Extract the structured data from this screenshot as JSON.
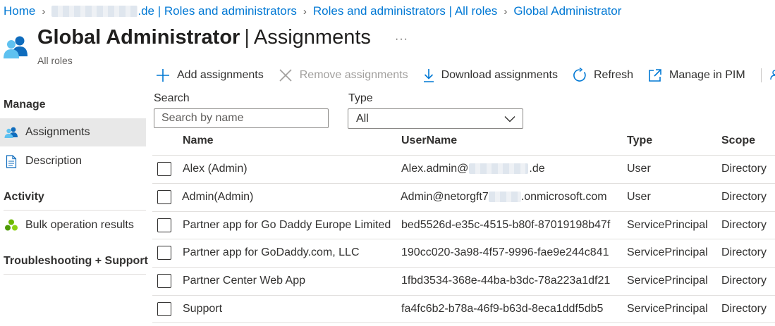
{
  "breadcrumb": {
    "home": "Home",
    "tenant_suffix": ".de | Roles and administrators",
    "roles_all": "Roles and administrators | All roles",
    "current": "Global Administrator"
  },
  "header": {
    "title_strong": "Global Administrator",
    "title_sep": "|",
    "title_sub": "Assignments",
    "more": "···",
    "subtitle": "All roles"
  },
  "toolbar": {
    "add": "Add assignments",
    "remove": "Remove assignments",
    "download": "Download assignments",
    "refresh": "Refresh",
    "manage_pim": "Manage in PIM"
  },
  "sidebar": {
    "manage_heading": "Manage",
    "assignments": "Assignments",
    "description": "Description",
    "activity_heading": "Activity",
    "bulk": "Bulk operation results",
    "troubleshooting_heading": "Troubleshooting + Support"
  },
  "filters": {
    "search_label": "Search",
    "search_placeholder": "Search by name",
    "type_label": "Type",
    "type_value": "All"
  },
  "table": {
    "headers": {
      "name": "Name",
      "username": "UserName",
      "type": "Type",
      "scope": "Scope"
    },
    "rows": [
      {
        "name": "Alex (Admin)",
        "user_prefix": "Alex.admin@",
        "user_suffix": ".de",
        "type": "User",
        "scope": "Directory"
      },
      {
        "name": "Admin(Admin)",
        "user_prefix": "Admin@netorgft7",
        "user_suffix": ".onmicrosoft.com",
        "type": "User",
        "scope": "Directory"
      },
      {
        "name": "Partner app for Go Daddy Europe Limited",
        "username": "bed5526d-e35c-4515-b80f-87019198b47f",
        "type": "ServicePrincipal",
        "scope": "Directory"
      },
      {
        "name": "Partner app for GoDaddy.com, LLC",
        "username": "190cc020-3a98-4f57-9996-fae9e244c841",
        "type": "ServicePrincipal",
        "scope": "Directory"
      },
      {
        "name": "Partner Center Web App",
        "username": "1fbd3534-368e-44ba-b3dc-78a223a1df21",
        "type": "ServicePrincipal",
        "scope": "Directory"
      },
      {
        "name": "Support",
        "username": "fa4fc6b2-b78a-46f9-b63d-8eca1ddf5db5",
        "type": "ServicePrincipal",
        "scope": "Directory"
      }
    ]
  },
  "colors": {
    "link": "#0078d4",
    "text": "#323130",
    "muted": "#605e5c",
    "disabled": "#a19f9d",
    "selected_nav": "#e8e8e8"
  }
}
